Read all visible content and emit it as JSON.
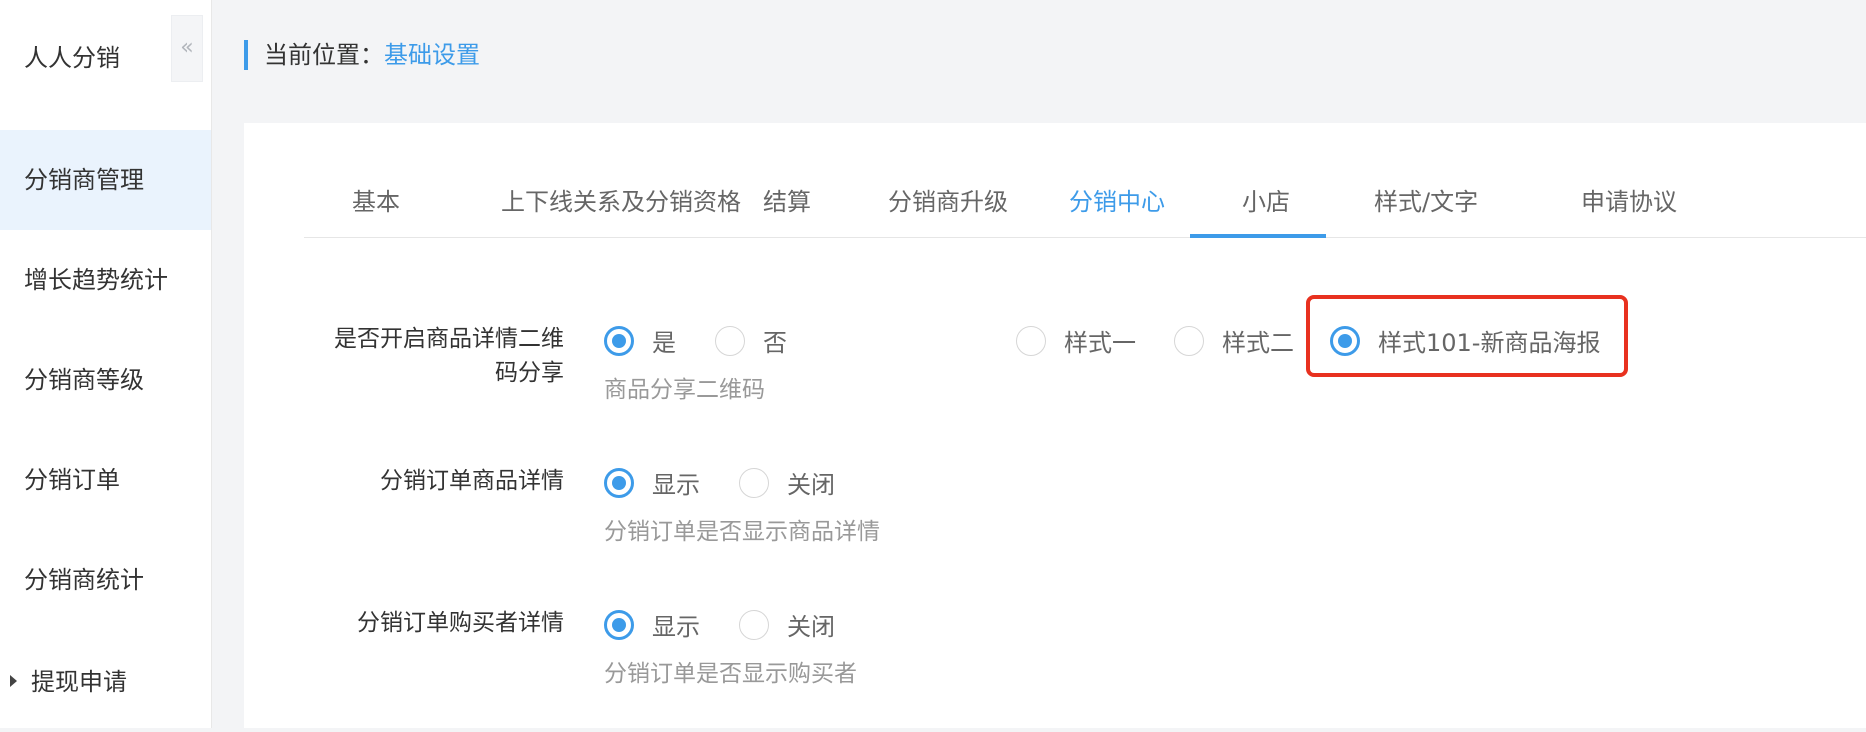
{
  "sidebar": {
    "app_title": "人人分销",
    "collapse_icon": "double-chevron-left-icon",
    "collapse_glyph": "«",
    "items": [
      {
        "label": "分销商管理",
        "active": true
      },
      {
        "label": "增长趋势统计"
      },
      {
        "label": "分销商等级"
      },
      {
        "label": "分销订单"
      },
      {
        "label": "分销商统计"
      },
      {
        "label": "提现申请",
        "expandable": true
      }
    ]
  },
  "breadcrumb": {
    "prefix": "当前位置：",
    "current": "基础设置"
  },
  "tabs": [
    {
      "label": "基本"
    },
    {
      "label": "上下线关系及分销资格"
    },
    {
      "label": "结算"
    },
    {
      "label": "分销商升级"
    },
    {
      "label": "分销中心",
      "active": true
    },
    {
      "label": "小店"
    },
    {
      "label": "样式/文字"
    },
    {
      "label": "申请协议"
    }
  ],
  "settings": {
    "qr_share": {
      "label_line1": "是否开启商品详情二维",
      "label_line2": "码分享",
      "options": [
        {
          "label": "是",
          "checked": true
        },
        {
          "label": "否",
          "checked": false
        }
      ],
      "style_options": [
        {
          "label": "样式一",
          "checked": false
        },
        {
          "label": "样式二",
          "checked": false
        },
        {
          "label": "样式101-新商品海报",
          "checked": true
        }
      ],
      "hint": "商品分享二维码"
    },
    "order_goods": {
      "label": "分销订单商品详情",
      "options": [
        {
          "label": "显示",
          "checked": true
        },
        {
          "label": "关闭",
          "checked": false
        }
      ],
      "hint": "分销订单是否显示商品详情"
    },
    "order_buyer": {
      "label": "分销订单购买者详情",
      "options": [
        {
          "label": "显示",
          "checked": true
        },
        {
          "label": "关闭",
          "checked": false
        }
      ],
      "hint": "分销订单是否显示购买者"
    }
  },
  "colors": {
    "accent": "#3d9be9",
    "highlight": "#e8311f",
    "active_nav_bg": "#eaf3fd"
  }
}
